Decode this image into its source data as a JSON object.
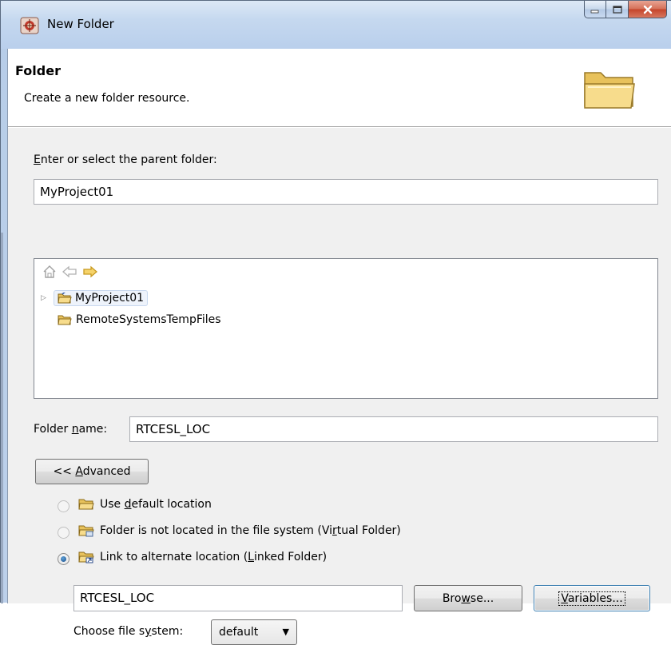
{
  "window": {
    "title": "New Folder",
    "buttons": {
      "minimize": "–",
      "maximize": "□",
      "close": "✕"
    }
  },
  "banner": {
    "title": "Folder",
    "description": "Create a new folder resource."
  },
  "parent": {
    "label_pre": "",
    "label_mnemonic": "E",
    "label_post": "nter or select the parent folder:",
    "value": "MyProject01"
  },
  "tree": {
    "items": [
      {
        "label": "MyProject01",
        "expandable": true,
        "selected": true
      },
      {
        "label": "RemoteSystemsTempFiles",
        "expandable": false,
        "selected": false
      }
    ]
  },
  "folder_name": {
    "label_pre": "Folder ",
    "label_mnemonic": "n",
    "label_post": "ame:",
    "value": "RTCESL_LOC"
  },
  "advanced_button": {
    "pre": "<< ",
    "mnemonic": "A",
    "post": "dvanced"
  },
  "location_options": [
    {
      "pre": "Use ",
      "mnemonic": "d",
      "post": "efault location",
      "checked": false
    },
    {
      "pre": "Folder is not located in the file system (Vi",
      "mnemonic": "r",
      "post": "tual Folder)",
      "checked": false
    },
    {
      "pre": "Link to alternate location (",
      "mnemonic": "L",
      "post": "inked Folder)",
      "checked": true
    }
  ],
  "link_location": {
    "value": "RTCESL_LOC"
  },
  "browse_button": {
    "pre": "Bro",
    "mnemonic": "w",
    "post": "se..."
  },
  "variables_button": {
    "pre": "",
    "mnemonic": "V",
    "post": "ariables..."
  },
  "file_system": {
    "label_pre": "Choose file s",
    "label_mnemonic": "y",
    "label_post": "stem:",
    "value": "default"
  },
  "colors": {
    "titlebar": "#c5d8ef",
    "body_background": "#f0f0f0",
    "folder_yellow": "#f5d77a",
    "close_red": "#c4442a"
  },
  "icons": [
    "app-icon",
    "folder-wizard-icon",
    "home-icon",
    "back-arrow-icon",
    "forward-arrow-icon",
    "project-folder-icon",
    "folder-icon",
    "linked-folder-icon",
    "virtual-folder-icon"
  ]
}
